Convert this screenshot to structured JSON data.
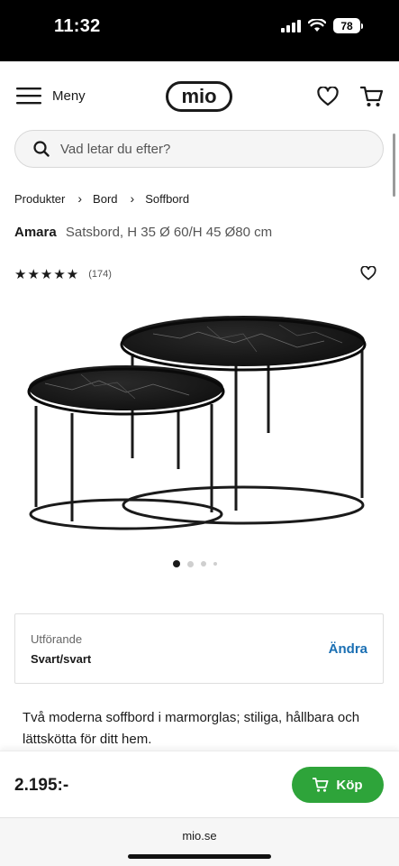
{
  "status_bar": {
    "time": "11:32",
    "battery": "78"
  },
  "header": {
    "menu_label": "Meny",
    "logo_text": "mio"
  },
  "search": {
    "placeholder": "Vad letar du efter?"
  },
  "breadcrumb": [
    "Produkter",
    "Bord",
    "Soffbord"
  ],
  "product": {
    "name": "Amara",
    "description": "Satsbord, H 35 Ø 60/H 45 Ø80 cm",
    "stars": "★★★★★",
    "rating_value": 5,
    "rating_count": "(174)",
    "carousel_current": 1,
    "carousel_total": 4
  },
  "variant": {
    "label": "Utförande",
    "value": "Svart/svart",
    "change_label": "Ändra"
  },
  "body_text": "Två moderna soffbord i marmorglas; stiliga, hållbara och lättskötta för ditt hem.",
  "buy": {
    "price": "2.195:-",
    "button_label": "Köp"
  },
  "browser": {
    "url": "mio.se"
  },
  "colors": {
    "accent_green": "#2ea43a",
    "link_blue": "#1a6fb3",
    "status_bg": "#000000"
  },
  "icons": [
    "menu-icon",
    "heart-icon",
    "cart-icon",
    "search-icon",
    "chevron-right-icon",
    "star-icon",
    "signal-icon",
    "wifi-icon",
    "battery-icon"
  ]
}
